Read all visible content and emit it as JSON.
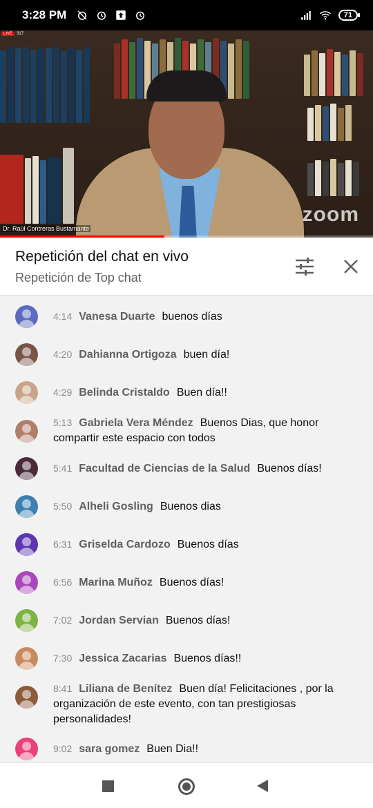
{
  "status_bar": {
    "time": "3:28 PM",
    "battery": "71",
    "icons": [
      "alarm-off-icon",
      "alarm-icon",
      "upload-icon",
      "alarm-icon",
      "signal-icon",
      "wifi-icon",
      "battery-icon"
    ]
  },
  "video": {
    "speaker_name": "Dr. Raúl Contreras Bustamante",
    "watermark": "zoom",
    "live_label": "LIVE",
    "viewer_count": "317",
    "progress_fraction": 0.44
  },
  "chat_header": {
    "title": "Repetición del chat en vivo",
    "subtitle": "Repetición de Top chat",
    "filter_icon": "tune-icon",
    "close_icon": "close-icon"
  },
  "messages": [
    {
      "time": "4:14",
      "author": "Vanesa Duarte",
      "text": "buenos días",
      "avatar_color": "#5c6bc0"
    },
    {
      "time": "4:20",
      "author": "Dahianna Ortigoza",
      "text": "buen día!",
      "avatar_color": "#795548"
    },
    {
      "time": "4:29",
      "author": "Belinda Cristaldo",
      "text": "Buen día!!",
      "avatar_color": "#c9a48a"
    },
    {
      "time": "5:13",
      "author": "Gabriela Vera Méndez",
      "text": "Buenos Dias, que honor compartir este espacio con todos",
      "avatar_color": "#b07f6a"
    },
    {
      "time": "5:41",
      "author": "Facultad de Ciencias de la Salud",
      "text": "Buenos días!",
      "avatar_color": "#4a2b3a"
    },
    {
      "time": "5:50",
      "author": "Alheli Gosling",
      "text": "Buenos dias",
      "avatar_color": "#3c7fb0"
    },
    {
      "time": "6:31",
      "author": "Griselda Cardozo",
      "text": "Buenos días",
      "avatar_color": "#5e35b1"
    },
    {
      "time": "6:56",
      "author": "Marina Muñoz",
      "text": "Buenos días!",
      "avatar_color": "#ab47bc"
    },
    {
      "time": "7:02",
      "author": "Jordan Servian",
      "text": "Buenos días!",
      "avatar_color": "#7cb342"
    },
    {
      "time": "7:30",
      "author": "Jessica Zacarias",
      "text": "Buenos días!!",
      "avatar_color": "#c98b5e"
    },
    {
      "time": "8:41",
      "author": "Liliana de Benítez",
      "text": "Buen día! Felicitaciones , por la organización de este evento, con tan prestigiosas personalidades!",
      "avatar_color": "#8d5a3b"
    },
    {
      "time": "9:02",
      "author": "sara gomez",
      "text": "Buen Dia!!",
      "avatar_color": "#ec407a"
    }
  ],
  "nav_bar": {
    "icons": [
      "recents-square-icon",
      "home-circle-icon",
      "back-triangle-icon"
    ]
  }
}
